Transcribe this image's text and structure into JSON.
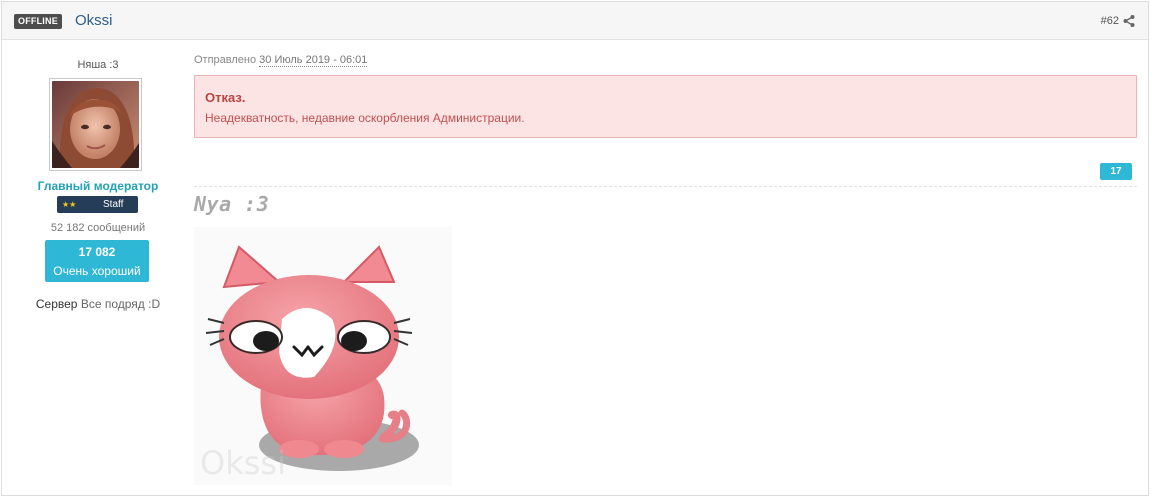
{
  "header": {
    "status_badge": "OFFLINE",
    "author": "Okssi",
    "post_number": "#62"
  },
  "author_panel": {
    "user_title": "Няша :3",
    "group": "Главный модератор",
    "staff_badge": {
      "stars": "★★",
      "label": "Staff"
    },
    "post_count": "52 182 сообщений",
    "reputation": {
      "value": "17 082",
      "label": "Очень хороший"
    },
    "server_label": "Сервер",
    "server_value": "Все подряд :D"
  },
  "post": {
    "meta_label": "Отправлено",
    "date": "30 Июль 2019 - 06:01",
    "notice": {
      "title": "Отказ.",
      "text": "Неадекватность, недавние оскорбления Администрации."
    },
    "like_count": "17",
    "signature_text": "Nya :3",
    "signature_watermark": "Okssi"
  },
  "colors": {
    "accent": "#2eb8d6",
    "group": "#23a3b3",
    "notice_bg": "#fde4e4",
    "notice_text": "#b84444",
    "badge_dark": "#263d59"
  },
  "icons": {
    "share": "share-icon",
    "avatar": "avatar-photo"
  }
}
